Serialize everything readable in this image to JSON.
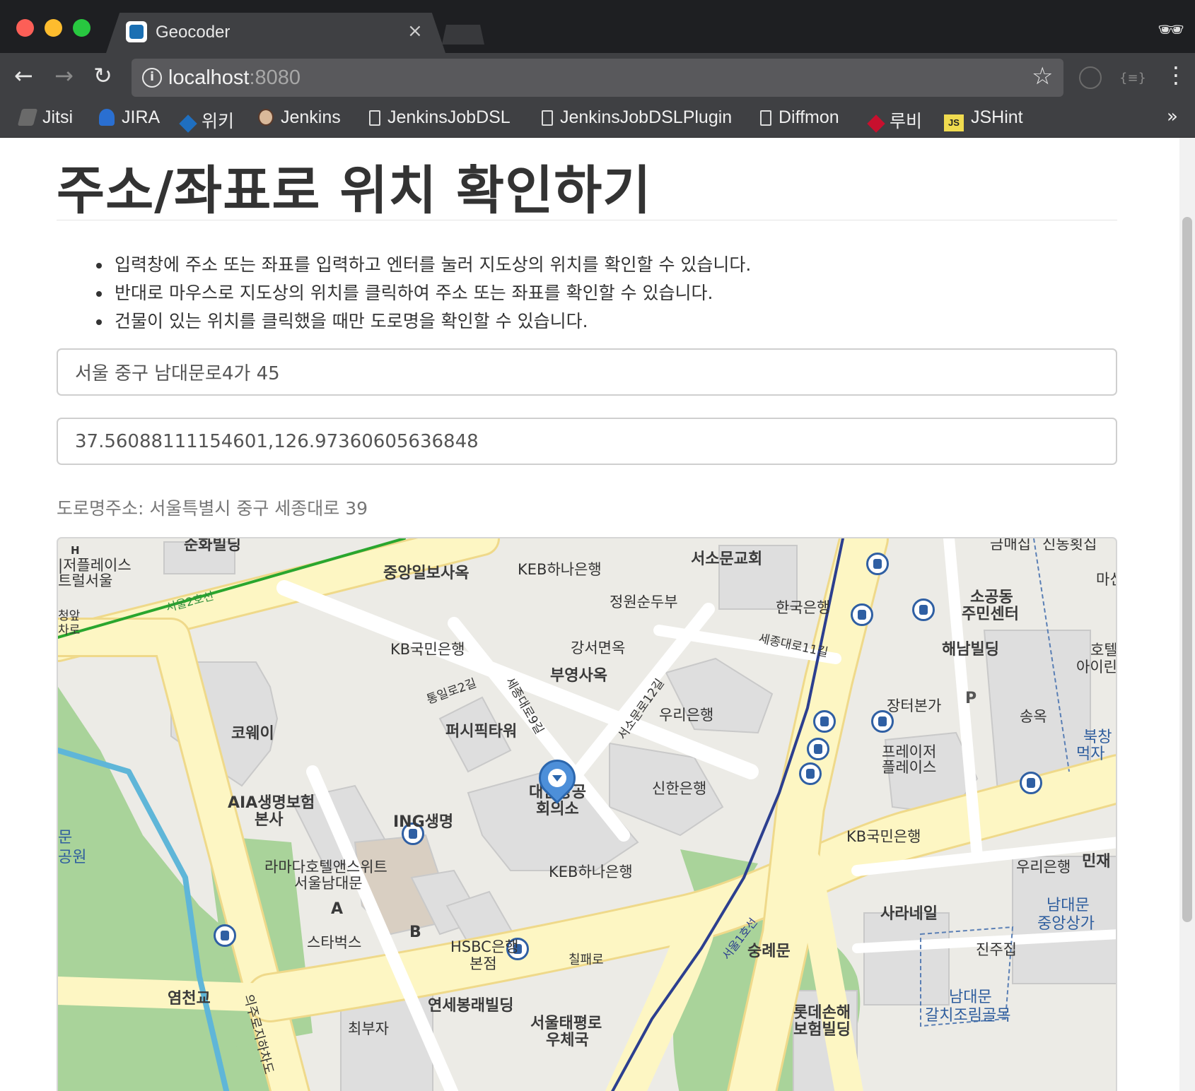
{
  "browser": {
    "tab_title": "Geocoder",
    "tab_close": "×",
    "url_host": "localhost",
    "url_port": ":8080",
    "icons": {
      "back": "←",
      "forward": "→",
      "reload": "↻",
      "info": "i",
      "star": "☆",
      "menu": "⋮",
      "more": "»",
      "ext": "{≡}",
      "incognito": "🕶"
    },
    "bookmarks": [
      {
        "label": "Jitsi",
        "icon": "jitsi-icon"
      },
      {
        "label": "JIRA",
        "icon": "jira-icon"
      },
      {
        "label": "위키",
        "icon": "wiki-icon"
      },
      {
        "label": "Jenkins",
        "icon": "jenkins-icon"
      },
      {
        "label": "JenkinsJobDSL",
        "icon": "file-icon"
      },
      {
        "label": "JenkinsJobDSLPlugin",
        "icon": "file-icon"
      },
      {
        "label": "Diffmon",
        "icon": "file-icon"
      },
      {
        "label": "루비",
        "icon": "ruby-icon"
      },
      {
        "label": "JSHint",
        "icon": "js-icon",
        "badge": "JS"
      }
    ]
  },
  "page": {
    "title": "주소/좌표로 위치 확인하기",
    "bullets": [
      "입력창에 주소 또는 좌표를 입력하고 엔터를 눌러 지도상의 위치를 확인할 수 있습니다.",
      "반대로 마우스로 지도상의 위치를 클릭하여 주소 또는 좌표를 확인할 수 있습니다.",
      "건물이 있는 위치를 클릭했을 때만 도로명을 확인할 수 있습니다."
    ],
    "address_value": "서울 중구 남대문로4가 45",
    "coordinate_value": "37.56088111154601,126.97360605636848",
    "road_address": "도로명주소: 서울특별시 중구 세종대로 39"
  },
  "map": {
    "colors": {
      "background": "#ecebe6",
      "road": "#fdf6c3",
      "road_edge": "#efd98a",
      "park": "#a9d39a",
      "building": "#dedede",
      "subway_line2": "#2aa62e",
      "subway_line1": "#2c3f8f",
      "stream": "#5fb6d8"
    },
    "labels": {
      "soonhwa": "순화빌딩",
      "joongang": "중앙일보사옥",
      "keb_top": "KEB하나은행",
      "seosomun_church": "서소문교회",
      "plaza_hotel_1": "|저플레이스",
      "plaza_hotel_2": "트럴서울",
      "jeongwon": "정원순두부",
      "hanguk_bank": "한국은행",
      "sogong_1": "소공동",
      "sogong_2": "주민센터",
      "line2": "서울2호선",
      "city_hall_1": "청앞",
      "city_hall_2": "차로",
      "kb_1": "KB국민은행",
      "gangseo": "강서면옥",
      "sejong11": "세종대로11길",
      "haenam": "해남빌딩",
      "hotel_1": "호텔",
      "hotel_2": "아이린",
      "buyoung": "부영사옥",
      "tongil2": "통일로2길",
      "sejong9": "세종대로9길",
      "seosomun12": "서소문로12길",
      "woori_1": "우리은행",
      "jangteo": "장터본가",
      "songok": "송옥",
      "bukchang_1": "북창",
      "bukchang_2": "먹자",
      "coway": "코웨이",
      "pacific": "퍼시픽타워",
      "fraser_1": "프레이저",
      "fraser_2": "플레이스",
      "shinhan": "신한은행",
      "aia_1": "AIA생명보험",
      "aia_2": "본사",
      "chamber_1": "대한상공",
      "chamber_2": "회의소",
      "ing": "ING생명",
      "kb_2": "KB국민은행",
      "woori_2": "우리은행",
      "minjae": "민재",
      "ramada_1": "라마다호텔앤스위트",
      "ramada_2": "서울남대문",
      "keb_bottom": "KEB하나은행",
      "park_1": "문",
      "park_2": "공원",
      "sarangil": "사라네일",
      "namdaemun_market_1": "남대문",
      "namdaemun_market_2": "중앙상가",
      "starbucks": "스타벅스",
      "hsbc_1": "HSBC은행",
      "hsbc_2": "본점",
      "chilpae": "칠패로",
      "sungnyemun": "숭례문",
      "jinju": "진주집",
      "line1": "서울1호선",
      "yeomcheon": "염천교",
      "uiju": "의주로지하차도",
      "yonsei": "연세봉래빌딩",
      "taepyeong_1": "서울태평로",
      "taepyeong_2": "우체국",
      "lotte_1": "롯데손해",
      "lotte_2": "보험빌딩",
      "galchi_1": "남대문",
      "galchi_2": "갈치조림골목",
      "choebuja": "최부자",
      "sinsong": "신동횟집",
      "gumaejip": "금매집",
      "mashin": "마신",
      "label_a": "A",
      "label_b": "B",
      "label_p": "P",
      "label_h": "H"
    }
  }
}
